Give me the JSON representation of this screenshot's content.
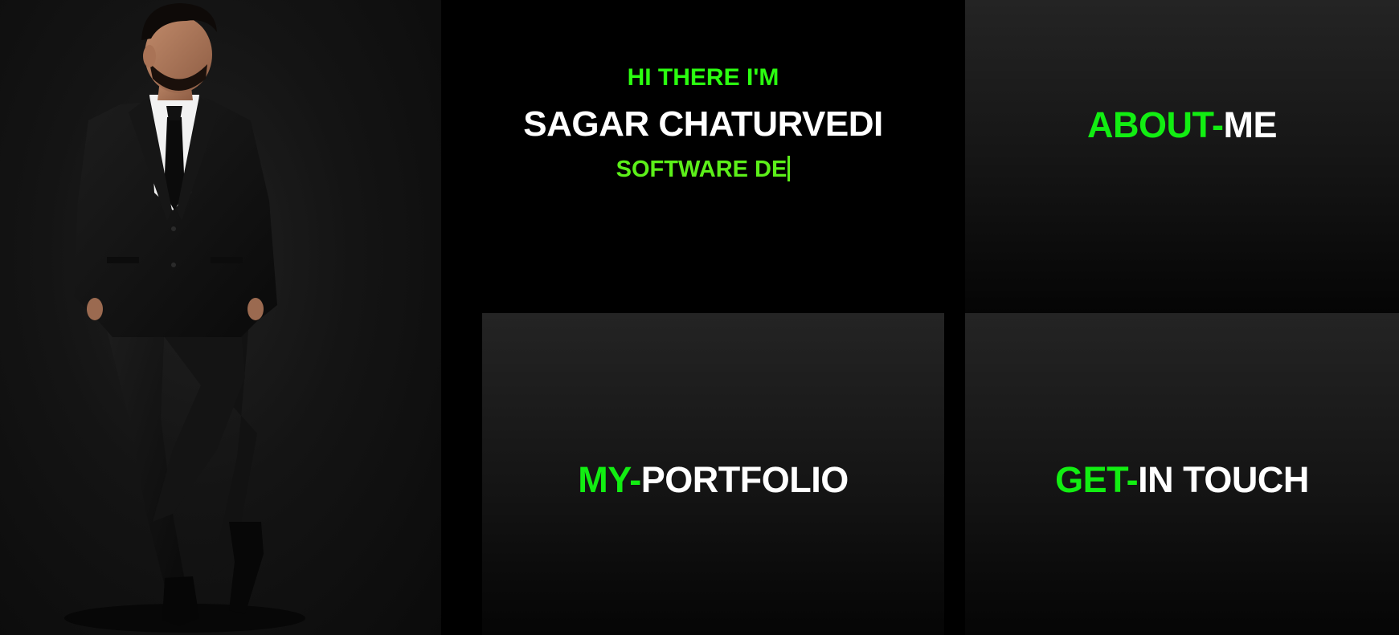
{
  "hero": {
    "greeting": "HI THERE I'M",
    "name": "SAGAR CHATURVEDI",
    "role_typed": "SOFTWARE DE"
  },
  "tiles": {
    "about": {
      "accent": "ABOUT-",
      "rest": "ME"
    },
    "portfolio": {
      "accent": "MY-",
      "rest": "PORTFOLIO"
    },
    "contact": {
      "accent": "GET-",
      "rest": "IN TOUCH"
    }
  },
  "colors": {
    "background": "#000000",
    "accent_green": "#12ee12",
    "role_green": "#5cf019",
    "text_white": "#ffffff",
    "tile_top": "#242424",
    "tile_bottom": "#050505"
  },
  "icons": {
    "portrait": "person-in-black-suit-photo",
    "typing_cursor": "text-cursor"
  }
}
